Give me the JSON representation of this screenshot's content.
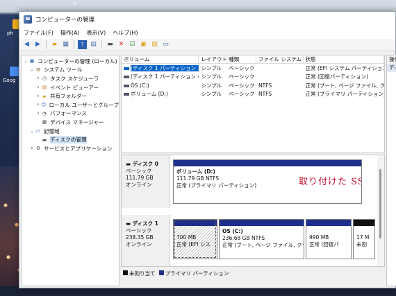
{
  "desktop": {
    "icons": [
      {
        "label": "ph",
        "color": "#f2b01e"
      },
      {
        "label": "Goog",
        "color": "#4a8cf0"
      }
    ],
    "top_glyph": "ト"
  },
  "window": {
    "title": "コンピューターの管理",
    "menu": [
      "ファイル(F)",
      "操作(A)",
      "表示(V)",
      "ヘルプ(H)"
    ],
    "toolbar_icons": [
      "back-arrow-icon",
      "forward-arrow-icon",
      "folder-up-icon",
      "show-tree-icon",
      "help-icon",
      "properties-icon",
      "connect-icon",
      "delete-icon",
      "check-icon",
      "export-icon",
      "new-icon",
      "refresh-icon"
    ]
  },
  "tree": {
    "items": [
      {
        "indent": 0,
        "toggle": "v",
        "label": "コンピューターの管理 (ローカル)",
        "icon": "computer-icon"
      },
      {
        "indent": 1,
        "toggle": "v",
        "label": "システム ツール",
        "icon": "tools-icon"
      },
      {
        "indent": 2,
        "toggle": ">",
        "label": "タスク スケジューラ",
        "icon": "clock-icon"
      },
      {
        "indent": 2,
        "toggle": ">",
        "label": "イベント ビューアー",
        "icon": "event-icon"
      },
      {
        "indent": 2,
        "toggle": ">",
        "label": "共有フォルダー",
        "icon": "folder-icon"
      },
      {
        "indent": 2,
        "toggle": ">",
        "label": "ローカル ユーザーとグループ",
        "icon": "users-icon"
      },
      {
        "indent": 2,
        "toggle": ">",
        "label": "パフォーマンス",
        "icon": "performance-icon"
      },
      {
        "indent": 2,
        "toggle": "",
        "label": "デバイス マネージャー",
        "icon": "device-icon"
      },
      {
        "indent": 1,
        "toggle": "v",
        "label": "記憶域",
        "icon": "storage-icon"
      },
      {
        "indent": 2,
        "toggle": "",
        "label": "ディスクの管理",
        "icon": "disk-icon",
        "selected": true
      },
      {
        "indent": 1,
        "toggle": ">",
        "label": "サービスとアプリケーション",
        "icon": "services-icon"
      }
    ]
  },
  "volumes": {
    "headers": [
      "ボリューム",
      "レイアウト",
      "種類",
      "ファイル システム",
      "状態"
    ],
    "rows": [
      [
        "(ディスク 1 パーティション 1)",
        "シンプル",
        "ベーシック",
        "",
        "正常 (EFI システム パーティション)"
      ],
      [
        "(ディスク 1 パーティション 4)",
        "シンプル",
        "ベーシック",
        "",
        "正常 (回復パーティション)"
      ],
      [
        "OS (C:)",
        "シンプル",
        "ベーシック",
        "NTFS",
        "正常 (ブート, ページ ファイル, クラ"
      ],
      [
        "ボリューム (D:)",
        "シンプル",
        "ベーシック",
        "NTFS",
        "正常 (プライマリ パーティション)"
      ]
    ]
  },
  "disks": [
    {
      "name": "ディスク 0",
      "type": "ベーシック",
      "size": "111.79 GB",
      "status": "オンライン",
      "partitions": [
        {
          "title": "ボリューム (D:)",
          "size": "111.79 GB NTFS",
          "status": "正常 (プライマリ パーティション)"
        }
      ],
      "annotation": "取り付けた SSD"
    },
    {
      "name": "ディスク 1",
      "type": "ベーシック",
      "size": "238.35 GB",
      "status": "オンライン",
      "partitions": [
        {
          "title": "",
          "size": "700 MB",
          "status": "正常 (EFI シス"
        },
        {
          "title": "OS (C:)",
          "size": "236.68 GB NTFS",
          "status": "正常 (ブート, ページ ファイル, クラ"
        },
        {
          "title": "",
          "size": "990 MB",
          "status": "正常 (回復パ"
        },
        {
          "title": "",
          "size": "17 M",
          "status": "未割"
        }
      ]
    }
  ],
  "legend": [
    {
      "label": "未割り当て",
      "color": "#111111"
    },
    {
      "label": "プライマリ パーティション",
      "color": "#1e2f8a"
    }
  ],
  "actions": {
    "header": "操作",
    "item": "ディ"
  }
}
